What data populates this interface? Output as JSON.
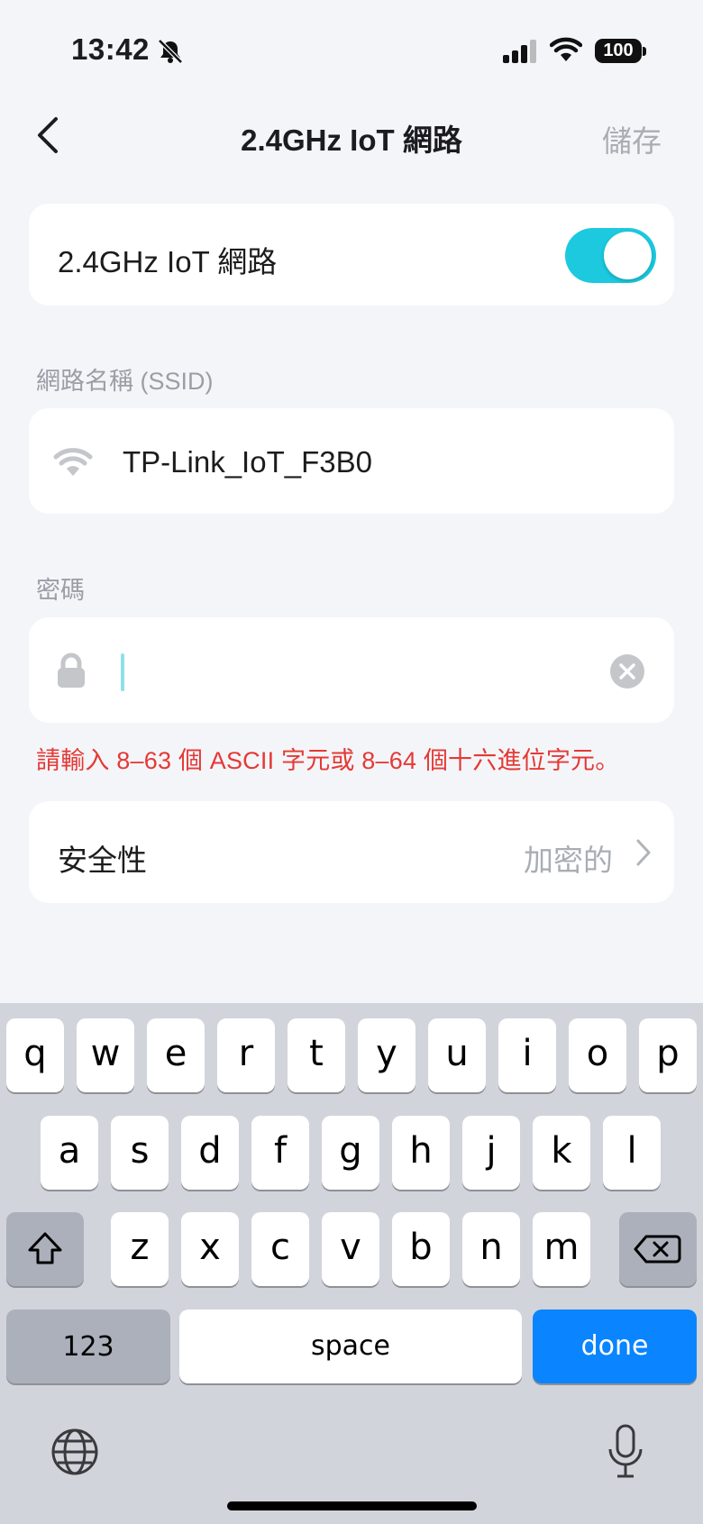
{
  "status_bar": {
    "time": "13:42",
    "battery": "100"
  },
  "nav": {
    "title": "2.4GHz IoT 網路",
    "save_label": "儲存"
  },
  "iot_toggle": {
    "label": "2.4GHz IoT 網路",
    "enabled": true
  },
  "ssid": {
    "section_label": "網路名稱 (SSID)",
    "value": "TP-Link_IoT_F3B0"
  },
  "password": {
    "section_label": "密碼",
    "value": "",
    "error": "請輸入 8–63 個 ASCII 字元或 8–64 個十六進位字元。"
  },
  "security": {
    "label": "安全性",
    "value": "加密的"
  },
  "keyboard": {
    "row1": [
      "q",
      "w",
      "e",
      "r",
      "t",
      "y",
      "u",
      "i",
      "o",
      "p"
    ],
    "row2": [
      "a",
      "s",
      "d",
      "f",
      "g",
      "h",
      "j",
      "k",
      "l"
    ],
    "row3": [
      "z",
      "x",
      "c",
      "v",
      "b",
      "n",
      "m"
    ],
    "numbers_label": "123",
    "space_label": "space",
    "done_label": "done"
  },
  "colors": {
    "accent": "#1cc9df",
    "error": "#e53935",
    "keyboard_done": "#0a84ff"
  }
}
